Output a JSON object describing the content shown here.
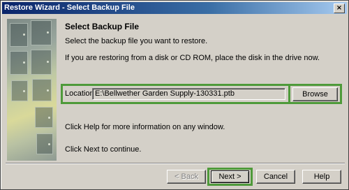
{
  "window": {
    "title": "Restore Wizard - Select Backup File",
    "close_glyph": "×"
  },
  "page": {
    "heading": "Select Backup File",
    "instruction": "Select the backup file you want to restore.",
    "disk_note": "If you are restoring from a disk or CD ROM, place the disk in the drive now.",
    "help_note": "Click Help for more information on any window.",
    "next_note": "Click Next to continue."
  },
  "location": {
    "label": "Location:",
    "value": "E:\\Bellwether Garden Supply-130331.ptb",
    "browse_label": "Browse"
  },
  "buttons": {
    "back_label": "< Back",
    "next_label": "Next >",
    "cancel_label": "Cancel",
    "help_label": "Help"
  },
  "colors": {
    "highlight": "#4e9a3a",
    "titlebar_start": "#0a246a",
    "face": "#d4d0c8"
  }
}
